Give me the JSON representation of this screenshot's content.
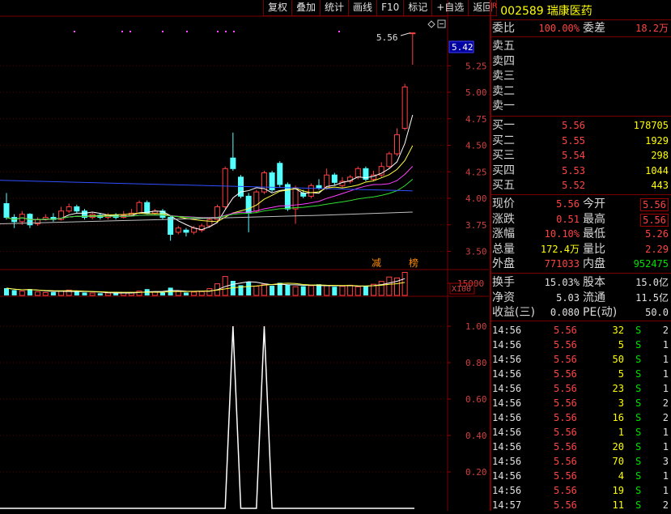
{
  "toolbar": {
    "buttons": [
      "复权",
      "叠加",
      "统计",
      "画线",
      "F10",
      "标记",
      "+自选",
      "返回"
    ]
  },
  "stock": {
    "badge": "R",
    "code": "002589",
    "name": "瑞康医药"
  },
  "commission": {
    "ratio_label": "委比",
    "ratio": "100.00%",
    "diff_label": "委差",
    "diff": "18.2万"
  },
  "asks": [
    {
      "label": "卖五"
    },
    {
      "label": "卖四"
    },
    {
      "label": "卖三"
    },
    {
      "label": "卖二"
    },
    {
      "label": "卖一"
    }
  ],
  "bids": [
    {
      "label": "买一",
      "price": "5.56",
      "vol": "178705"
    },
    {
      "label": "买二",
      "price": "5.55",
      "vol": "1929"
    },
    {
      "label": "买三",
      "price": "5.54",
      "vol": "298"
    },
    {
      "label": "买四",
      "price": "5.53",
      "vol": "1044"
    },
    {
      "label": "买五",
      "price": "5.52",
      "vol": "443"
    }
  ],
  "quote": [
    {
      "l1": "现价",
      "v1": "5.56",
      "c1": "red",
      "l2": "今开",
      "v2": "5.56",
      "c2": "red",
      "b2": true
    },
    {
      "l1": "涨跌",
      "v1": "0.51",
      "c1": "red",
      "l2": "最高",
      "v2": "5.56",
      "c2": "red",
      "b2": true
    },
    {
      "l1": "涨幅",
      "v1": "10.10%",
      "c1": "red",
      "l2": "最低",
      "v2": "5.26",
      "c2": "red",
      "b2": false
    },
    {
      "l1": "总量",
      "v1": "172.4万",
      "c1": "yellow",
      "l2": "量比",
      "v2": "2.29",
      "c2": "red",
      "b2": false
    },
    {
      "l1": "外盘",
      "v1": "771033",
      "c1": "red",
      "l2": "内盘",
      "v2": "952475",
      "c2": "green",
      "b2": false
    }
  ],
  "fund": [
    {
      "l1": "换手",
      "v1": "15.03%",
      "l2": "股本",
      "v2": "15.0亿"
    },
    {
      "l1": "净资",
      "v1": "5.03",
      "l2": "流通",
      "v2": "11.5亿"
    },
    {
      "l1": "收益(三)",
      "v1": "0.080",
      "l2": "PE(动)",
      "v2": "50.0"
    }
  ],
  "trades": [
    {
      "t": "14:56",
      "p": "5.56",
      "v": "32",
      "s": "S",
      "n": "2"
    },
    {
      "t": "14:56",
      "p": "5.56",
      "v": "5",
      "s": "S",
      "n": "1"
    },
    {
      "t": "14:56",
      "p": "5.56",
      "v": "50",
      "s": "S",
      "n": "1"
    },
    {
      "t": "14:56",
      "p": "5.56",
      "v": "5",
      "s": "S",
      "n": "1"
    },
    {
      "t": "14:56",
      "p": "5.56",
      "v": "23",
      "s": "S",
      "n": "1"
    },
    {
      "t": "14:56",
      "p": "5.56",
      "v": "3",
      "s": "S",
      "n": "2"
    },
    {
      "t": "14:56",
      "p": "5.56",
      "v": "16",
      "s": "S",
      "n": "2"
    },
    {
      "t": "14:56",
      "p": "5.56",
      "v": "1",
      "s": "S",
      "n": "1"
    },
    {
      "t": "14:56",
      "p": "5.56",
      "v": "20",
      "s": "S",
      "n": "1"
    },
    {
      "t": "14:56",
      "p": "5.56",
      "v": "70",
      "s": "S",
      "n": "3"
    },
    {
      "t": "14:56",
      "p": "5.56",
      "v": "4",
      "s": "S",
      "n": "1"
    },
    {
      "t": "14:56",
      "p": "5.56",
      "v": "19",
      "s": "S",
      "n": "1"
    },
    {
      "t": "14:57",
      "p": "5.56",
      "v": "11",
      "s": "S",
      "n": "2"
    }
  ],
  "chart_data": {
    "type": "candlestick",
    "price_axis": {
      "ticks": [
        5.25,
        5.0,
        4.75,
        4.5,
        4.25,
        4.0,
        3.75,
        3.5
      ],
      "current": "5.42",
      "high_label": "5.56"
    },
    "volume_axis": {
      "tick": "15000",
      "unit": "X100"
    },
    "indicator_axis": {
      "ticks": [
        1.0,
        0.8,
        0.6,
        0.4,
        0.2
      ]
    },
    "tags": [
      "减",
      "榜"
    ],
    "candles": [
      {
        "o": 3.95,
        "c": 3.82,
        "h": 4.05,
        "l": 3.8
      },
      {
        "o": 3.82,
        "c": 3.78,
        "h": 3.85,
        "l": 3.72
      },
      {
        "o": 3.78,
        "c": 3.85,
        "h": 3.88,
        "l": 3.75
      },
      {
        "o": 3.85,
        "c": 3.75,
        "h": 3.86,
        "l": 3.72
      },
      {
        "o": 3.76,
        "c": 3.8,
        "h": 3.82,
        "l": 3.74
      },
      {
        "o": 3.8,
        "c": 3.82,
        "h": 3.85,
        "l": 3.79
      },
      {
        "o": 3.82,
        "c": 3.8,
        "h": 3.86,
        "l": 3.78
      },
      {
        "o": 3.8,
        "c": 3.88,
        "h": 3.92,
        "l": 3.79
      },
      {
        "o": 3.88,
        "c": 3.92,
        "h": 3.95,
        "l": 3.86
      },
      {
        "o": 3.92,
        "c": 3.88,
        "h": 3.94,
        "l": 3.86
      },
      {
        "o": 3.88,
        "c": 3.82,
        "h": 3.9,
        "l": 3.8
      },
      {
        "o": 3.82,
        "c": 3.85,
        "h": 3.87,
        "l": 3.8
      },
      {
        "o": 3.84,
        "c": 3.82,
        "h": 3.86,
        "l": 3.8
      },
      {
        "o": 3.82,
        "c": 3.84,
        "h": 3.86,
        "l": 3.8
      },
      {
        "o": 3.84,
        "c": 3.82,
        "h": 3.86,
        "l": 3.8
      },
      {
        "o": 3.82,
        "c": 3.84,
        "h": 3.88,
        "l": 3.81
      },
      {
        "o": 3.84,
        "c": 3.86,
        "h": 3.9,
        "l": 3.83
      },
      {
        "o": 3.86,
        "c": 3.96,
        "h": 3.98,
        "l": 3.85
      },
      {
        "o": 3.96,
        "c": 3.86,
        "h": 3.98,
        "l": 3.85
      },
      {
        "o": 3.86,
        "c": 3.88,
        "h": 3.9,
        "l": 3.84
      },
      {
        "o": 3.88,
        "c": 3.82,
        "h": 3.9,
        "l": 3.8
      },
      {
        "o": 3.82,
        "c": 3.66,
        "h": 3.84,
        "l": 3.6
      },
      {
        "o": 3.68,
        "c": 3.72,
        "h": 3.74,
        "l": 3.66
      },
      {
        "o": 3.7,
        "c": 3.68,
        "h": 3.72,
        "l": 3.64
      },
      {
        "o": 3.68,
        "c": 3.72,
        "h": 3.74,
        "l": 3.66
      },
      {
        "o": 3.7,
        "c": 3.74,
        "h": 3.76,
        "l": 3.68
      },
      {
        "o": 3.74,
        "c": 3.8,
        "h": 3.82,
        "l": 3.72
      },
      {
        "o": 3.8,
        "c": 3.92,
        "h": 3.94,
        "l": 3.78
      },
      {
        "o": 3.92,
        "c": 4.28,
        "h": 4.3,
        "l": 3.9
      },
      {
        "o": 4.38,
        "c": 4.28,
        "h": 4.62,
        "l": 4.26
      },
      {
        "o": 4.2,
        "c": 4.02,
        "h": 4.22,
        "l": 4.0
      },
      {
        "o": 4.02,
        "c": 3.86,
        "h": 4.05,
        "l": 3.68
      },
      {
        "o": 3.88,
        "c": 4.06,
        "h": 4.08,
        "l": 3.86
      },
      {
        "o": 4.06,
        "c": 4.24,
        "h": 4.26,
        "l": 4.04
      },
      {
        "o": 4.24,
        "c": 4.08,
        "h": 4.26,
        "l": 4.06
      },
      {
        "o": 4.33,
        "c": 4.13,
        "h": 4.35,
        "l": 4.1
      },
      {
        "o": 4.13,
        "c": 3.9,
        "h": 4.15,
        "l": 3.88
      },
      {
        "o": 3.9,
        "c": 4.1,
        "h": 4.12,
        "l": 3.76
      },
      {
        "o": 4.05,
        "c": 4.02,
        "h": 4.08,
        "l": 4.0
      },
      {
        "o": 4.02,
        "c": 4.12,
        "h": 4.14,
        "l": 4.0
      },
      {
        "o": 4.12,
        "c": 4.1,
        "h": 4.18,
        "l": 4.08
      },
      {
        "o": 4.1,
        "c": 4.22,
        "h": 4.28,
        "l": 4.08
      },
      {
        "o": 4.22,
        "c": 4.15,
        "h": 4.24,
        "l": 4.12
      },
      {
        "o": 4.12,
        "c": 4.16,
        "h": 4.2,
        "l": 4.1
      },
      {
        "o": 4.16,
        "c": 4.2,
        "h": 4.22,
        "l": 4.14
      },
      {
        "o": 4.2,
        "c": 4.28,
        "h": 4.3,
        "l": 4.18
      },
      {
        "o": 4.28,
        "c": 4.18,
        "h": 4.3,
        "l": 4.16
      },
      {
        "o": 4.18,
        "c": 4.22,
        "h": 4.26,
        "l": 4.16
      },
      {
        "o": 4.22,
        "c": 4.3,
        "h": 4.34,
        "l": 4.2
      },
      {
        "o": 4.3,
        "c": 4.42,
        "h": 4.44,
        "l": 4.28
      },
      {
        "o": 4.42,
        "c": 4.6,
        "h": 4.66,
        "l": 4.4
      },
      {
        "o": 4.66,
        "c": 5.05,
        "h": 5.08,
        "l": 4.64
      },
      {
        "o": 5.56,
        "c": 5.56,
        "h": 5.56,
        "l": 5.26
      }
    ],
    "volumes": [
      30,
      22,
      18,
      26,
      15,
      12,
      14,
      18,
      22,
      16,
      12,
      10,
      9,
      10,
      9,
      11,
      12,
      18,
      26,
      15,
      12,
      32,
      16,
      12,
      14,
      16,
      28,
      48,
      78,
      60,
      42,
      55,
      38,
      46,
      40,
      52,
      44,
      36,
      38,
      40,
      46,
      40,
      36,
      38,
      42,
      36,
      40,
      46,
      58,
      76,
      72,
      95
    ],
    "indicator": [
      {
        "i": 0,
        "v": 0
      },
      {
        "i": 23,
        "v": 0
      },
      {
        "i": 24,
        "v": 1
      },
      {
        "i": 25,
        "v": 0
      },
      {
        "i": 27,
        "v": 0
      },
      {
        "i": 28,
        "v": 1
      },
      {
        "i": 29,
        "v": 0
      },
      {
        "i": 52,
        "v": 0
      }
    ]
  }
}
